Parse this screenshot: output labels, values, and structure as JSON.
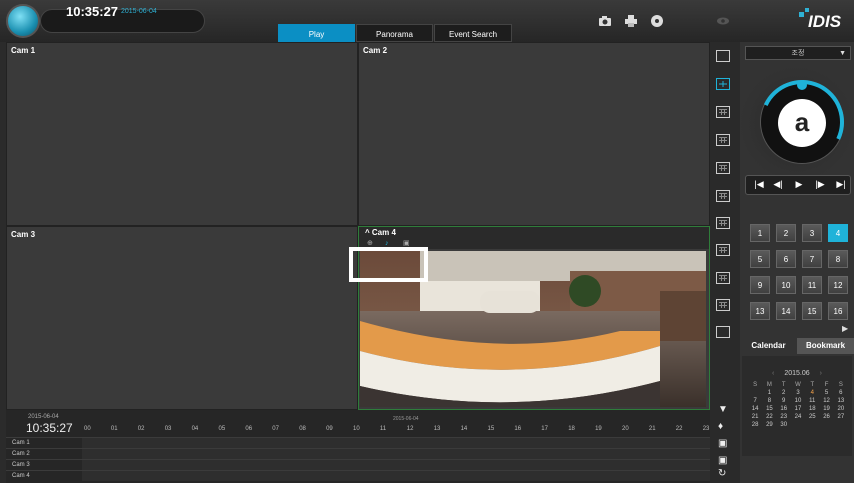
{
  "header": {
    "time": "10:35:27",
    "date": "2015-06-04",
    "tabs": [
      {
        "label": "Play",
        "active": true
      },
      {
        "label": "Panorama",
        "active": false
      },
      {
        "label": "Event Search",
        "active": false
      }
    ],
    "icons": [
      "camera-icon",
      "printer-icon",
      "disc-icon",
      "eye-icon"
    ],
    "brand": "IDIS",
    "accent_color": "#1fb3d9"
  },
  "cameras": [
    {
      "label": "Cam 1"
    },
    {
      "label": "Cam 2"
    },
    {
      "label": "Cam 3"
    },
    {
      "label": "Cam 4"
    }
  ],
  "layout_icons": [
    "single-layout-icon",
    "quad-layout-icon",
    "grid-3x3-icon",
    "grid-4x4-icon",
    "grid-5x5-icon",
    "grid-6x6-icon",
    "grid-1p5-icon",
    "grid-1p7-icon",
    "grid-1p12-icon",
    "grid-custom-icon",
    "fisheye-layout-icon"
  ],
  "panel": {
    "dropdown": "조정",
    "playback_buttons": [
      "|◀",
      "◀|",
      "▶",
      "|▶",
      "▶|"
    ],
    "numbers": [
      "1",
      "2",
      "3",
      "4",
      "5",
      "6",
      "7",
      "8",
      "9",
      "10",
      "11",
      "12",
      "13",
      "14",
      "15",
      "16"
    ],
    "active_number": "4",
    "calendar_tabs": [
      "Calendar",
      "Bookmark"
    ],
    "month": "2015.06",
    "weekdays": [
      "S",
      "M",
      "T",
      "W",
      "T",
      "F",
      "S"
    ],
    "days": [
      "",
      "1",
      "2",
      "3",
      "4",
      "5",
      "6",
      "7",
      "8",
      "9",
      "10",
      "11",
      "12",
      "13",
      "14",
      "15",
      "16",
      "17",
      "18",
      "19",
      "20",
      "21",
      "22",
      "23",
      "24",
      "25",
      "26",
      "27",
      "28",
      "29",
      "30"
    ],
    "selected_day": "4"
  },
  "timeline": {
    "date": "2015-06-04",
    "time": "10:35:27",
    "mid_date": "2015-06-04",
    "hours": [
      "00",
      "01",
      "02",
      "03",
      "04",
      "05",
      "06",
      "07",
      "08",
      "09",
      "10",
      "11",
      "12",
      "13",
      "14",
      "15",
      "16",
      "17",
      "18",
      "19",
      "20",
      "21",
      "22",
      "23"
    ],
    "rows": [
      "Cam 1",
      "Cam 2",
      "Cam 3",
      "Cam 4"
    ]
  }
}
